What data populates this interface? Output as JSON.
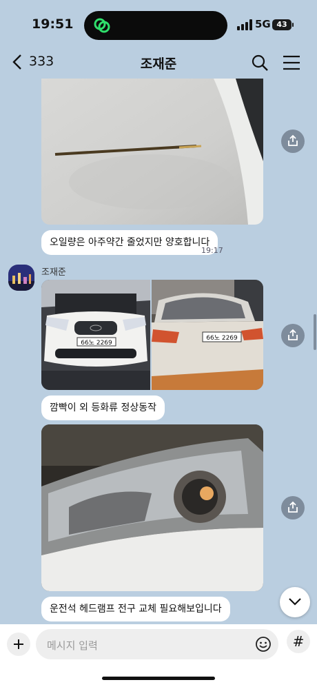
{
  "status_bar": {
    "time": "19:51",
    "network": "5G",
    "battery": "43"
  },
  "header": {
    "back_label": "333",
    "title": "조재준"
  },
  "messages": [
    {
      "type": "image",
      "description": "car hood with oil dipstick"
    },
    {
      "type": "text",
      "text": "오일량은 아주약간 줄었지만 양호합니다",
      "time": "19:17"
    },
    {
      "type": "image_pair",
      "sender": "조재준",
      "plates": [
        "66노 2269",
        "66노 2269"
      ]
    },
    {
      "type": "text",
      "text": "깜빡이 외 등화류 정상동작"
    },
    {
      "type": "image",
      "description": "headlamp close-up"
    },
    {
      "type": "text",
      "text": "운전석 헤드램프 전구 교체 필요해보입니다"
    }
  ],
  "input": {
    "placeholder": "메시지 입력",
    "hash_label": "#"
  },
  "colors": {
    "background": "#bacee0",
    "bubble": "#ffffff",
    "share_button": "#7e8c9c"
  }
}
